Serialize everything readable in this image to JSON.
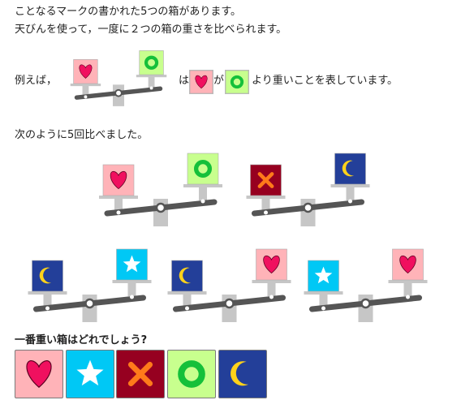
{
  "intro": {
    "line1": "ことなるマークの書かれた5つの箱があります。",
    "line2": "天びんを使って，一度に２つの箱の重さを比べられます。"
  },
  "example": {
    "prefix": "例えば，",
    "wa": "は",
    "ga": "が",
    "suffix": "より重いことを表しています。",
    "heavier": "heart",
    "lighter": "ring"
  },
  "comparisons_intro": "次のように5回比べました。",
  "comparisons": [
    {
      "heavier": "heart",
      "lighter": "ring"
    },
    {
      "heavier": "cross",
      "lighter": "moon"
    },
    {
      "heavier": "moon",
      "lighter": "star"
    },
    {
      "heavier": "moon",
      "lighter": "heart"
    },
    {
      "heavier": "star",
      "lighter": "heart"
    }
  ],
  "question": "一番重い箱はどれでしょう?",
  "choices": [
    {
      "id": "heart",
      "icon": "heart-icon"
    },
    {
      "id": "star",
      "icon": "star-icon"
    },
    {
      "id": "cross",
      "icon": "cross-icon"
    },
    {
      "id": "ring",
      "icon": "ring-icon"
    },
    {
      "id": "moon",
      "icon": "moon-icon"
    }
  ],
  "colors": {
    "heart_bg": "#ffb3b8",
    "heart_fg": "#f0105f",
    "star_bg": "#00c8f5",
    "star_fg": "#ffffff",
    "cross_bg": "#960020",
    "cross_fg": "#ff7a1a",
    "ring_bg": "#c8ff8e",
    "ring_fg": "#15c03a",
    "moon_bg": "#233f99",
    "moon_fg": "#ffd21a",
    "scale_beam": "#555555",
    "scale_post": "#c6c6c6"
  }
}
